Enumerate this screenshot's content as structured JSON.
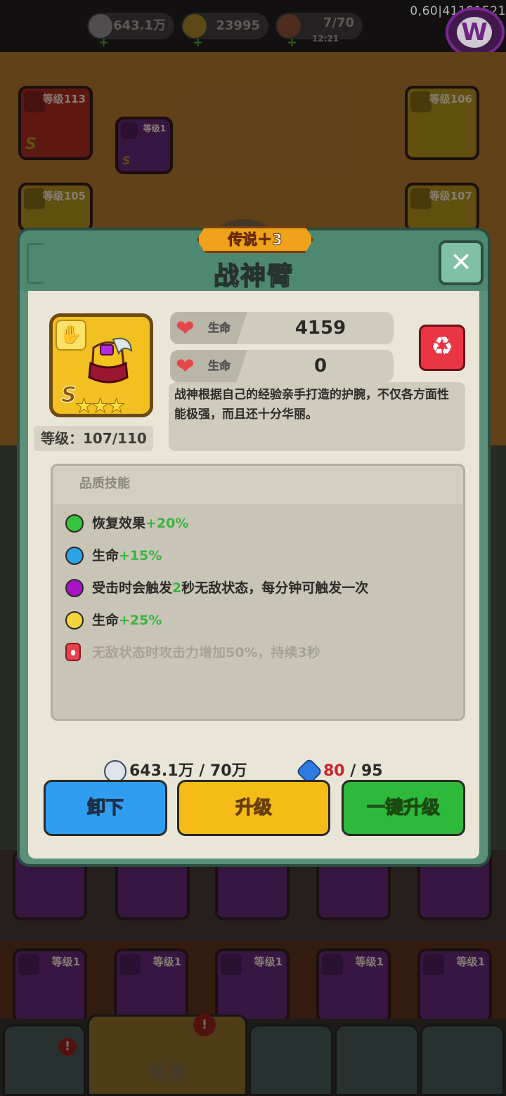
{
  "topbar": {
    "silver": "643.1万",
    "gold": "23995",
    "stamina": "7/70",
    "stamina_timer": "12:21",
    "perf_overlay": "0,60|41181521"
  },
  "background": {
    "slots": [
      {
        "level": "等级113",
        "rank": "S"
      },
      {
        "level": "等级1",
        "rank": "S"
      },
      {
        "level": "等级106",
        "rank": ""
      },
      {
        "level": "等级105",
        "rank": ""
      },
      {
        "level": "等级107",
        "rank": ""
      }
    ],
    "bottom_slots": [
      "等级1",
      "等级1",
      "等级1",
      "等级1",
      "等级1"
    ],
    "nav_active_label": "装备"
  },
  "modal": {
    "rarity": "传说＋3",
    "title": "战神臂",
    "item_rank": "S",
    "stars": "★★★",
    "level_text": "等级：107/110",
    "stats": [
      {
        "name": "生命",
        "value": "4159"
      },
      {
        "name": "生命",
        "value": "0"
      }
    ],
    "description": "战神根据自己的经验亲手打造的护腕，不仅各方面性能极强，而且还十分华丽。",
    "skills_header": "品质技能",
    "skills": [
      {
        "color": "#35c43d",
        "text": "恢复效果",
        "bonus": "+20%"
      },
      {
        "color": "#2aa4e6",
        "text": "生命",
        "bonus": "+15%"
      },
      {
        "color": "#a814c4",
        "text_before": "受击时会触发",
        "bonus": "2",
        "text_after": "秒无敌状态，每分钟可触发一次"
      },
      {
        "color": "#f5d53a",
        "text": "生命",
        "bonus": "+25%"
      }
    ],
    "locked_skill": "无敌状态时攻击力增加50%，持续3秒",
    "cost_silver": "643.1万 / 70万",
    "cost_gem_have": "80",
    "cost_gem_need": " / 95",
    "buttons": {
      "unequip": "卸下",
      "upgrade": "升级",
      "auto_upgrade": "一键升级"
    }
  }
}
